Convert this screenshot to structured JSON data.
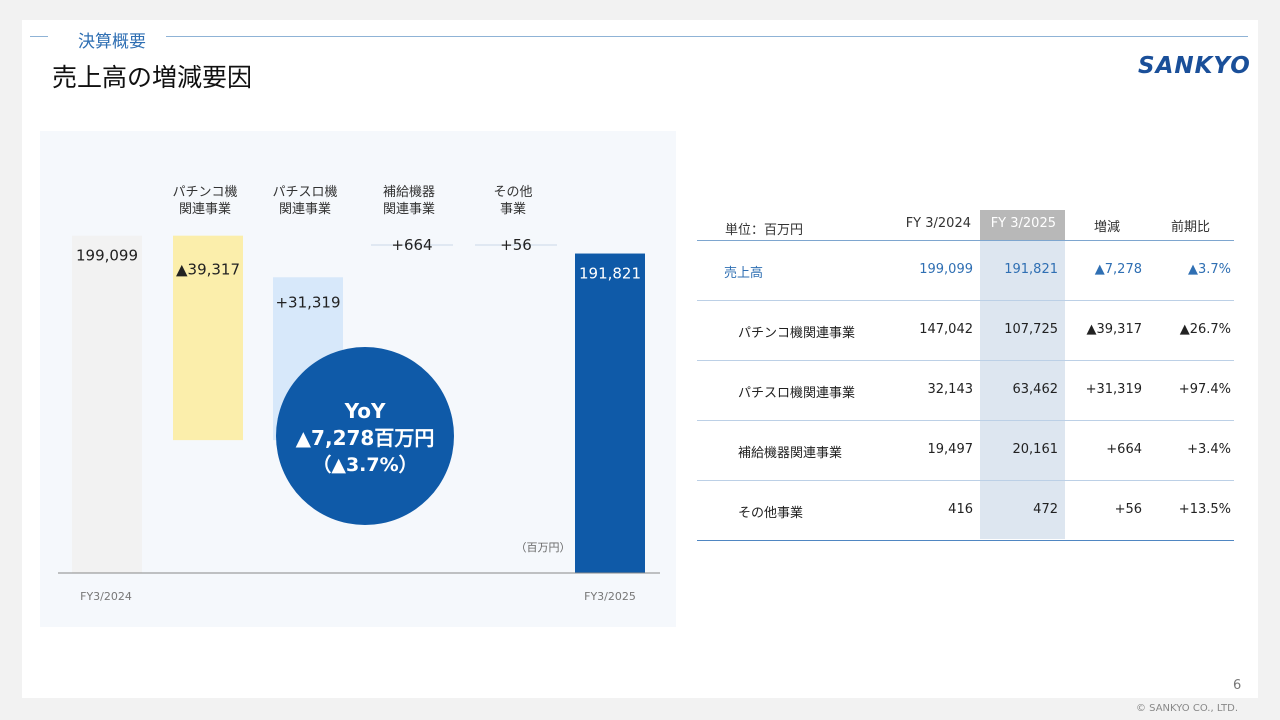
{
  "header": {
    "section": "決算概要",
    "title": "売上高の増減要因",
    "logo": "SANKYO"
  },
  "chart_data": {
    "type": "bar",
    "subtype": "waterfall",
    "categories": [
      "FY3/2024",
      "パチンコ機関連事業",
      "パチスロ機関連事業",
      "補給機器関連事業",
      "その他事業",
      "FY3/2025"
    ],
    "category_labels": [
      "パチンコ機\n関連事業",
      "パチスロ機\n関連事業",
      "補給機器\n関連事業",
      "その他\n事業"
    ],
    "values": [
      199099,
      -39317,
      31319,
      664,
      56,
      191821
    ],
    "value_labels": [
      "199,099",
      "▲39,317",
      "+31,319",
      "+664",
      "+56",
      "191,821"
    ],
    "x_labels": [
      "FY3/2024",
      "FY3/2025"
    ],
    "unit": "（百万円）",
    "colors": {
      "start": "#f2f2f2",
      "decrease": "#fbeeab",
      "increase": "#d7e8fa",
      "end": "#0f5aa8"
    },
    "ylim": [
      150000,
      200000
    ],
    "callout": {
      "line1": "YoY",
      "line2": "▲7,278百万円",
      "line3": "（▲3.7%）",
      "color": "#0f5aa8"
    }
  },
  "table": {
    "headers": [
      "単位：百万円",
      "FY 3/2024",
      "FY 3/2025",
      "増減",
      "前期比"
    ],
    "rows": [
      {
        "name": "売上高",
        "fy2024": "199,099",
        "fy2025": "191,821",
        "diff": "▲7,278",
        "ratio": "▲3.7%"
      },
      {
        "name": "パチンコ機関連事業",
        "fy2024": "147,042",
        "fy2025": "107,725",
        "diff": "▲39,317",
        "ratio": "▲26.7%"
      },
      {
        "name": "パチスロ機関連事業",
        "fy2024": "32,143",
        "fy2025": "63,462",
        "diff": "+31,319",
        "ratio": "+97.4%"
      },
      {
        "name": "補給機器関連事業",
        "fy2024": "19,497",
        "fy2025": "20,161",
        "diff": "+664",
        "ratio": "+3.4%"
      },
      {
        "name": "その他事業",
        "fy2024": "416",
        "fy2025": "472",
        "diff": "+56",
        "ratio": "+13.5%"
      }
    ]
  },
  "footer": {
    "page": "6",
    "copyright": "© SANKYO CO., LTD."
  }
}
